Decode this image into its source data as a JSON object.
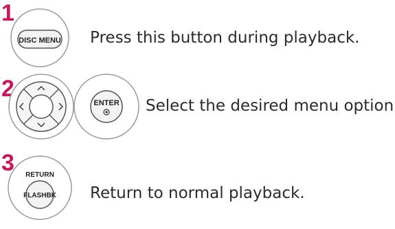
{
  "steps": [
    {
      "number": "1",
      "button_label": "DISC MENU",
      "instruction": "Press this button during playback."
    },
    {
      "number": "2",
      "dpad_icons": [
        "arrow-up-icon",
        "arrow-left-icon",
        "arrow-right-icon",
        "arrow-down-icon"
      ],
      "button_label": "ENTER",
      "instruction": "Select the desired menu option."
    },
    {
      "number": "3",
      "button_label_top": "RETURN",
      "button_label_bottom": "FLASHBK",
      "instruction": "Return to normal playback."
    }
  ],
  "colors": {
    "step_number": "#c8175d",
    "text": "#2b2b2b",
    "button_outline": "#8a8a8a"
  }
}
